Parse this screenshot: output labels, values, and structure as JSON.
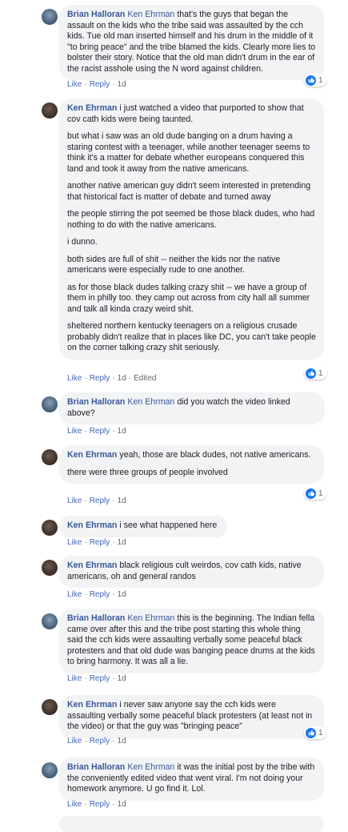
{
  "actions": {
    "like": "Like",
    "reply": "Reply",
    "edited": "Edited"
  },
  "comments": [
    {
      "author": "Brian Halloran",
      "mention": "Ken Ehrman",
      "paragraphs": [
        "that's the guys that began the assault on the kids who the tribe said was assaulted by the cch kids. Tue old man inserted himself and his drum in the middle of it \"to bring peace\" and the tribe blamed the kids. Clearly more lies to bolster their story. Notice that the old man didn't drum in the ear of the racist asshole using the N word against children."
      ],
      "time": "1d",
      "reactions": "1"
    },
    {
      "author": "Ken Ehrman",
      "mention": "",
      "paragraphs": [
        "i just watched a video that purported to show that cov cath kids were being taunted.",
        "but what i saw was an old dude banging on a drum having a staring contest with a teenager, while another teenager seems to think it's a matter for debate whether europeans conquered this land and took it away from the native americans.",
        "another native american guy didn't seem interested in pretending that historical fact is matter of debate and turned away",
        "the people stirring the pot seemed be those black dudes, who had nothing to do with the native americans.",
        "i dunno.",
        "both sides are full of shit -- neither the kids nor the native americans were especially rude to one another.",
        "as for those black dudes talking crazy shit -- we have a group of them in philly too. they camp out across from city hall all summer and talk all kinda crazy weird shit.",
        "sheltered northern kentucky teenagers on a religious crusade probably didn't realize that in places like DC, you can't take people on the corner talking crazy shit seriously."
      ],
      "time": "1d",
      "reactions": "1",
      "edited": true
    },
    {
      "author": "Brian Halloran",
      "mention": "Ken Ehrman",
      "paragraphs": [
        "did you watch the video linked above?"
      ],
      "time": "1d"
    },
    {
      "author": "Ken Ehrman",
      "mention": "",
      "paragraphs": [
        "yeah, those are black dudes, not native americans.",
        "there were three groups of people involved"
      ],
      "time": "1d",
      "reactions": "1"
    },
    {
      "author": "Ken Ehrman",
      "mention": "",
      "paragraphs": [
        "i see what happened here"
      ],
      "time": "1d"
    },
    {
      "author": "Ken Ehrman",
      "mention": "",
      "paragraphs": [
        "black religious cult weirdos, cov cath kids, native americans, oh and general randos"
      ],
      "time": "1d"
    },
    {
      "author": "Brian Halloran",
      "mention": "Ken Ehrman",
      "paragraphs": [
        "this is the beginning. The Indian fella came over after this and the tribe post starting this whole thing said the cch kids were assaulting verbally some peaceful black protesters and that old dude was banging peace drums at the kids to bring harmony. It was all a lie."
      ],
      "time": "1d"
    },
    {
      "author": "Ken Ehrman",
      "mention": "",
      "paragraphs": [
        "i never saw anyone say the cch kids were assaulting verbally some peaceful black protesters (at least not in the video) or that the guy was \"bringing peace\""
      ],
      "time": "1d",
      "reactions": "1"
    },
    {
      "author": "Brian Halloran",
      "mention": "Ken Ehrman",
      "paragraphs": [
        "it was the initial post by the tribe with the conveniently edited video that went viral. I'm not doing your homework anymore. U go find it. Lol."
      ],
      "time": "1d"
    }
  ]
}
